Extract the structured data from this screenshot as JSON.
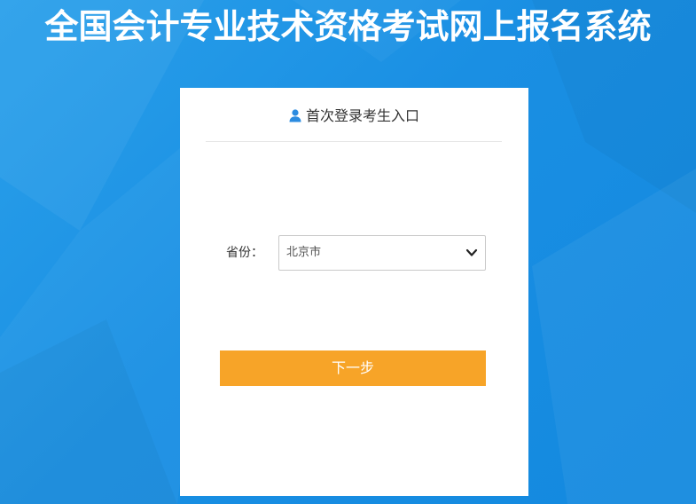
{
  "page": {
    "title": "全国会计专业技术资格考试网上报名系统"
  },
  "login_card": {
    "header_icon": "user-icon",
    "header_text": "首次登录考生入口",
    "province_label": "省份：",
    "province_selected": "北京市",
    "dropdown_icon": "chevron-down-icon",
    "next_button_label": "下一步"
  },
  "colors": {
    "background": "#1a8fe3",
    "card": "#ffffff",
    "accent_button": "#f7a428",
    "user_icon": "#2b8be0"
  }
}
